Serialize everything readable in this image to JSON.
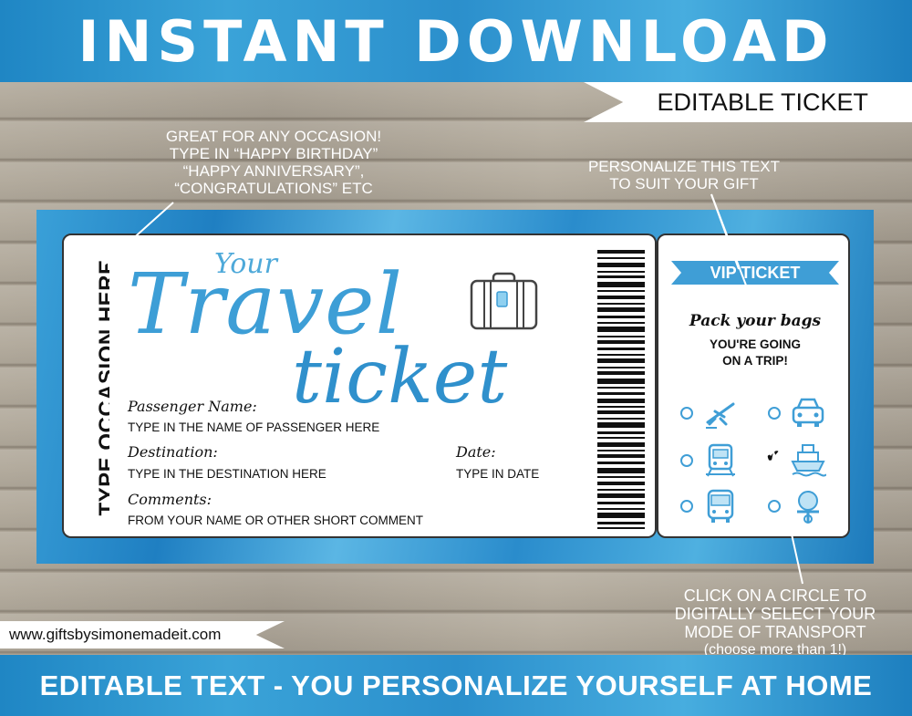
{
  "header": {
    "title": "INSTANT DOWNLOAD"
  },
  "badge_right": {
    "label": "EDITABLE TICKET"
  },
  "notes": {
    "occasion": [
      "GREAT FOR ANY OCCASION!",
      "TYPE IN “HAPPY BIRTHDAY”",
      "“HAPPY ANNIVERSARY”,",
      "“CONGRATULATIONS” ETC"
    ],
    "personalize": [
      "PERSONALIZE THIS TEXT",
      "TO SUIT YOUR GIFT"
    ],
    "circle": [
      "CLICK ON A CIRCLE TO",
      "DIGITALLY SELECT YOUR",
      "MODE OF TRANSPORT",
      "(choose more than 1!)"
    ]
  },
  "ticket": {
    "stub_text": "TYPE OCCASION HERE",
    "title_your": "Your",
    "title_travel": "Travel",
    "title_ticket": "ticket",
    "passenger_label": "Passenger Name:",
    "passenger_value": "TYPE IN THE NAME OF PASSENGER HERE",
    "destination_label": "Destination:",
    "destination_value": "TYPE IN THE DESTINATION HERE",
    "date_label": "Date:",
    "date_value": "TYPE IN DATE",
    "comments_label": "Comments:",
    "comments_value": "FROM YOUR NAME OR OTHER SHORT COMMENT"
  },
  "vip": {
    "ribbon": "VIP TICKET",
    "script": "Pack your bags",
    "line1": "YOU'RE GOING",
    "line2": "ON A TRIP!",
    "transport": [
      {
        "icon": "plane-icon",
        "checked": false
      },
      {
        "icon": "car-icon",
        "checked": false
      },
      {
        "icon": "train-icon",
        "checked": false
      },
      {
        "icon": "ship-icon",
        "checked": true
      },
      {
        "icon": "bus-icon",
        "checked": false
      },
      {
        "icon": "motorbike-icon",
        "checked": false
      }
    ]
  },
  "site": {
    "url": "www.giftsbysimonemadeit.com"
  },
  "footer": {
    "text": "EDITABLE TEXT - YOU PERSONALIZE YOURSELF AT HOME"
  },
  "colors": {
    "accent": "#3f9ed6",
    "dark": "#111111",
    "wood": "#aaa293"
  }
}
